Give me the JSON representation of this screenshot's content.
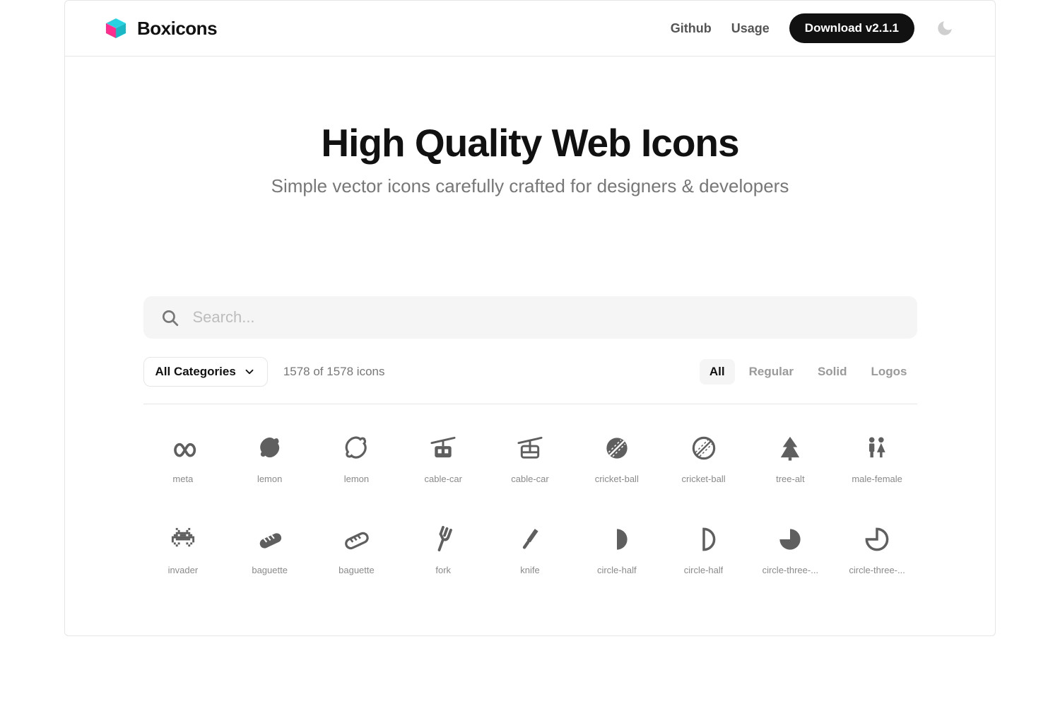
{
  "brand": {
    "name": "Boxicons"
  },
  "nav": {
    "github": "Github",
    "usage": "Usage",
    "download": "Download v2.1.1"
  },
  "hero": {
    "title": "High Quality Web Icons",
    "subtitle": "Simple vector icons carefully crafted for designers & developers"
  },
  "search": {
    "placeholder": "Search..."
  },
  "filters": {
    "category_label": "All Categories",
    "count_text": "1578 of 1578 icons",
    "styles": {
      "all": "All",
      "regular": "Regular",
      "solid": "Solid",
      "logos": "Logos"
    }
  },
  "icons": {
    "row1": [
      "meta",
      "lemon",
      "lemon",
      "cable-car",
      "cable-car",
      "cricket-ball",
      "cricket-ball",
      "tree-alt",
      "male-female"
    ],
    "row2": [
      "invader",
      "baguette",
      "baguette",
      "fork",
      "knife",
      "circle-half",
      "circle-half",
      "circle-three-...",
      "circle-three-..."
    ]
  }
}
